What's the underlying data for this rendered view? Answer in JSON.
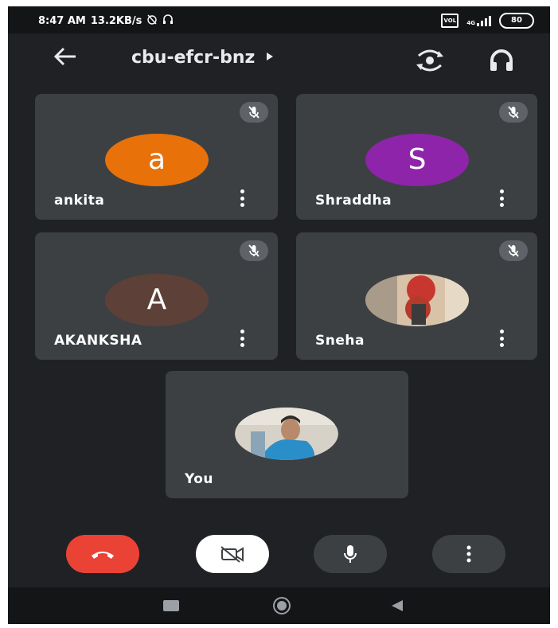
{
  "status_bar": {
    "time": "8:47 AM",
    "speed": "13.2KB/s",
    "alarm_icon": "alarm-off-icon",
    "headset_icon": "headset-icon",
    "sim_label": "VOL",
    "network": "4G",
    "battery": "80"
  },
  "app_bar": {
    "back_icon": "arrow-left-icon",
    "meeting_code": "cbu-efcr-bnz",
    "caret_icon": "caret-right-icon",
    "switch_camera_icon": "switch-camera-icon",
    "audio_icon": "headphones-icon"
  },
  "participants": [
    {
      "name": "ankita",
      "avatar_letter": "a",
      "avatar_color": "#e8710a",
      "muted": true
    },
    {
      "name": "Shraddha",
      "avatar_letter": "S",
      "avatar_color": "#8e24aa",
      "muted": true
    },
    {
      "name": "AKANKSHA",
      "avatar_letter": "A",
      "avatar_color": "#5d4037",
      "muted": true
    },
    {
      "name": "Sneha",
      "avatar_letter": "",
      "avatar_color": "#c9a98a",
      "muted": true,
      "photo": true
    },
    {
      "name": "You",
      "avatar_letter": "",
      "avatar_color": "#5a8fb8",
      "muted": false,
      "photo": true
    }
  ],
  "controls": {
    "end_call_color": "#ea4335",
    "camera_off_icon": "video-off-icon",
    "mic_icon": "mic-icon",
    "more_icon": "more-vertical-icon"
  },
  "nav": {
    "recents_icon": "square-icon",
    "home_icon": "circle-icon",
    "back_icon": "triangle-back-icon"
  }
}
